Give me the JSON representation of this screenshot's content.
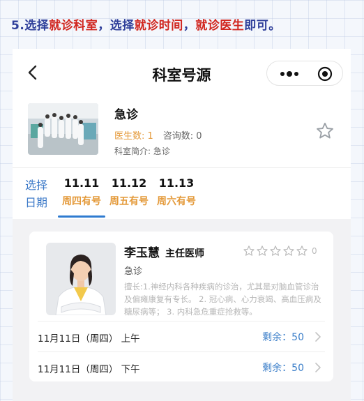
{
  "instruction": {
    "step": "5.",
    "p1": "选择",
    "p2": "就诊科室",
    "p3": "，选择",
    "p4": "就诊时间",
    "p5": "，",
    "p6": "就诊医生",
    "p7": "即可。"
  },
  "nav": {
    "title": "科室号源",
    "back_icon": "chevron-left-icon",
    "more_icon": "more-dots-icon",
    "close_icon": "target-circle-icon"
  },
  "department": {
    "name": "急诊",
    "doctor_count_label": "医生数: 1",
    "consult_count_label": "咨询数: 0",
    "intro": "科室简介: 急诊",
    "favorite_icon": "star-outline-icon"
  },
  "dates": {
    "choose_label": "选择日期",
    "items": [
      {
        "date": "11.11",
        "status": "周四有号",
        "selected": true
      },
      {
        "date": "11.12",
        "status": "周五有号",
        "selected": false
      },
      {
        "date": "11.13",
        "status": "周六有号",
        "selected": false
      }
    ]
  },
  "doctor": {
    "name": "李玉慧",
    "title": "主任医师",
    "department": "急诊",
    "rating_count": "0",
    "rating_stars": 0,
    "specialty": "擅长:1.神经内科各种疾病的诊治，尤其是对脑血管诊治及偏瘫康复有专长。 2. 冠心病、心力衰竭、高血压病及糖尿病等； 3. 内科急危重症抢救等。"
  },
  "slots": [
    {
      "date": "11月11日（周四） 上午",
      "remaining": "剩余：50"
    },
    {
      "date": "11月11日（周四） 下午",
      "remaining": "剩余：50"
    }
  ],
  "colors": {
    "accent_blue": "#2f7bd0",
    "orange": "#e49a3b",
    "instruction_red": "#d1261f",
    "instruction_blue": "#2f3f9a"
  }
}
